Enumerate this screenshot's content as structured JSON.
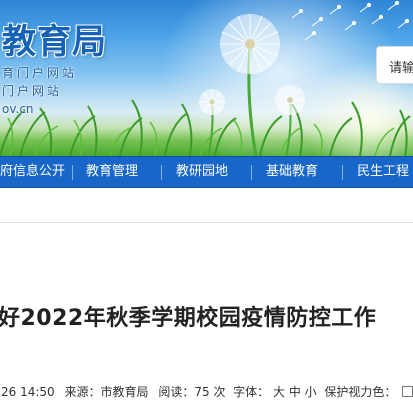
{
  "header": {
    "site_name": "教育局",
    "subtitle_line1": "育门户网站",
    "subtitle_line2": "门户网站",
    "domain": "ov.cn",
    "search_placeholder": "请输"
  },
  "nav": {
    "items": [
      "府信息公开",
      "教育管理",
      "教研园地",
      "基础教育",
      "民生工程"
    ]
  },
  "article": {
    "title": "好2022年秋季学期校园疫情防控工作",
    "meta": {
      "datetime": "26 14:50",
      "source_label": "来源：",
      "source": "市教育局",
      "reads_label": "阅读：",
      "reads_count": "75",
      "reads_unit": "次",
      "font_label": "字体：",
      "font_sizes": [
        "大",
        "中",
        "小"
      ],
      "eye_care_label": "保护视力色："
    }
  },
  "colors": {
    "nav_background": "#1867c8",
    "site_name": "#1662b6",
    "title_text": "#222222"
  }
}
